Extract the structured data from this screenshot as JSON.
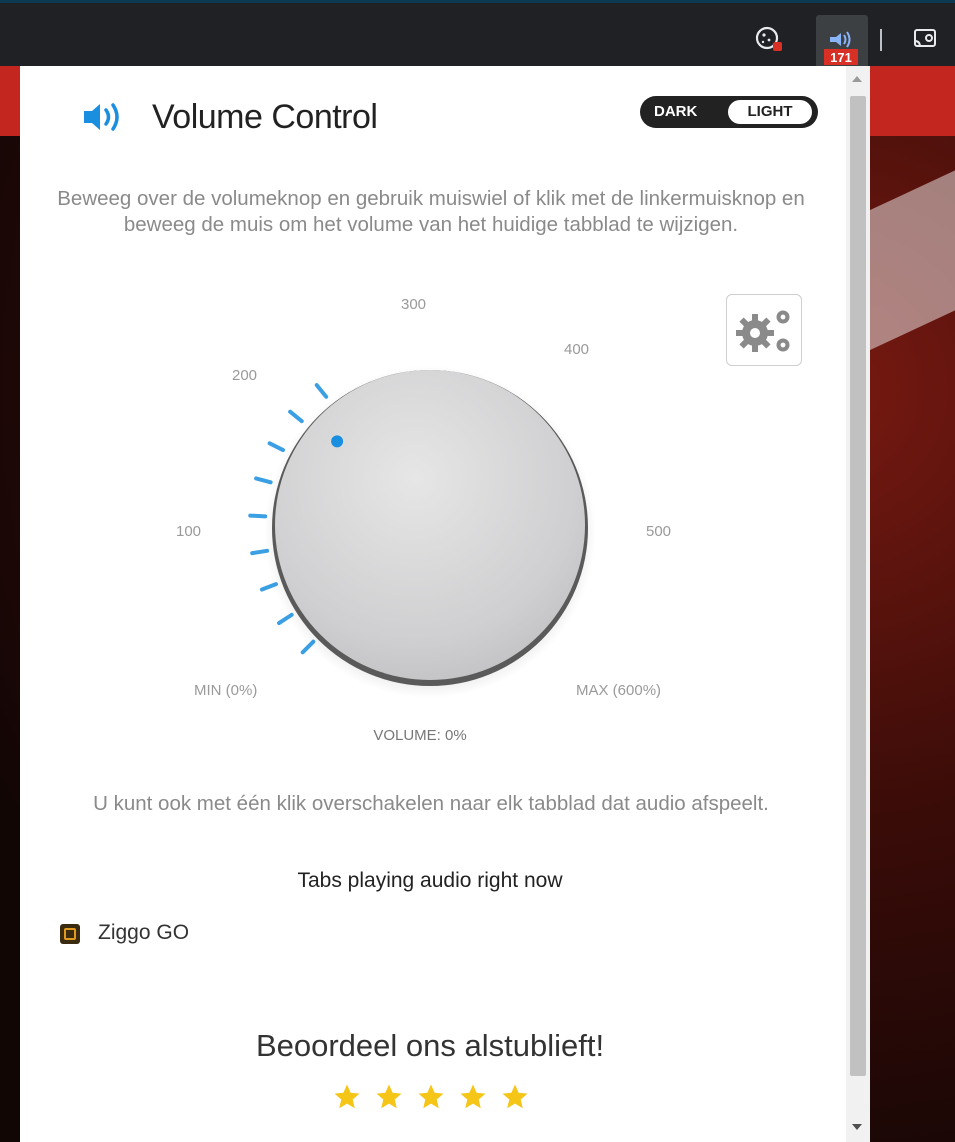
{
  "browser": {
    "extensions": [
      {
        "name": "cookie-extension",
        "icon": "cookie-icon"
      },
      {
        "name": "volume-control-extension",
        "icon": "volume-badge-icon",
        "badge": "171"
      },
      {
        "name": "cast",
        "icon": "cast-icon"
      }
    ]
  },
  "popup": {
    "title": "Volume Control",
    "theme_toggle": {
      "dark_label": "DARK",
      "light_label": "LIGHT",
      "selected": "LIGHT"
    },
    "description": "Beweeg over de volumeknop en gebruik muiswiel of klik met de linkermuisknop en beweeg de muis om het volume van het huidige tabblad te wijzigen.",
    "dial": {
      "labels": {
        "min": "MIN (0%)",
        "l100": "100",
        "l200": "200",
        "l300": "300",
        "l400": "400",
        "l500": "500",
        "max": "MAX (600%)"
      },
      "volume_readout": "VOLUME: 0%",
      "volume_percent": 0,
      "max_percent": 600,
      "accent_color": "#1a8fe0"
    },
    "audio_hint": "U kunt ook met één klik overschakelen naar elk tabblad dat audio afspeelt.",
    "tabs_heading": "Tabs playing audio right now",
    "tabs": [
      {
        "label": "Ziggo GO",
        "icon": "ziggo-go-icon"
      }
    ],
    "rating": {
      "heading": "Beoordeel ons alstublieft!",
      "star_count": 5,
      "star_color": "#f5c518"
    }
  }
}
